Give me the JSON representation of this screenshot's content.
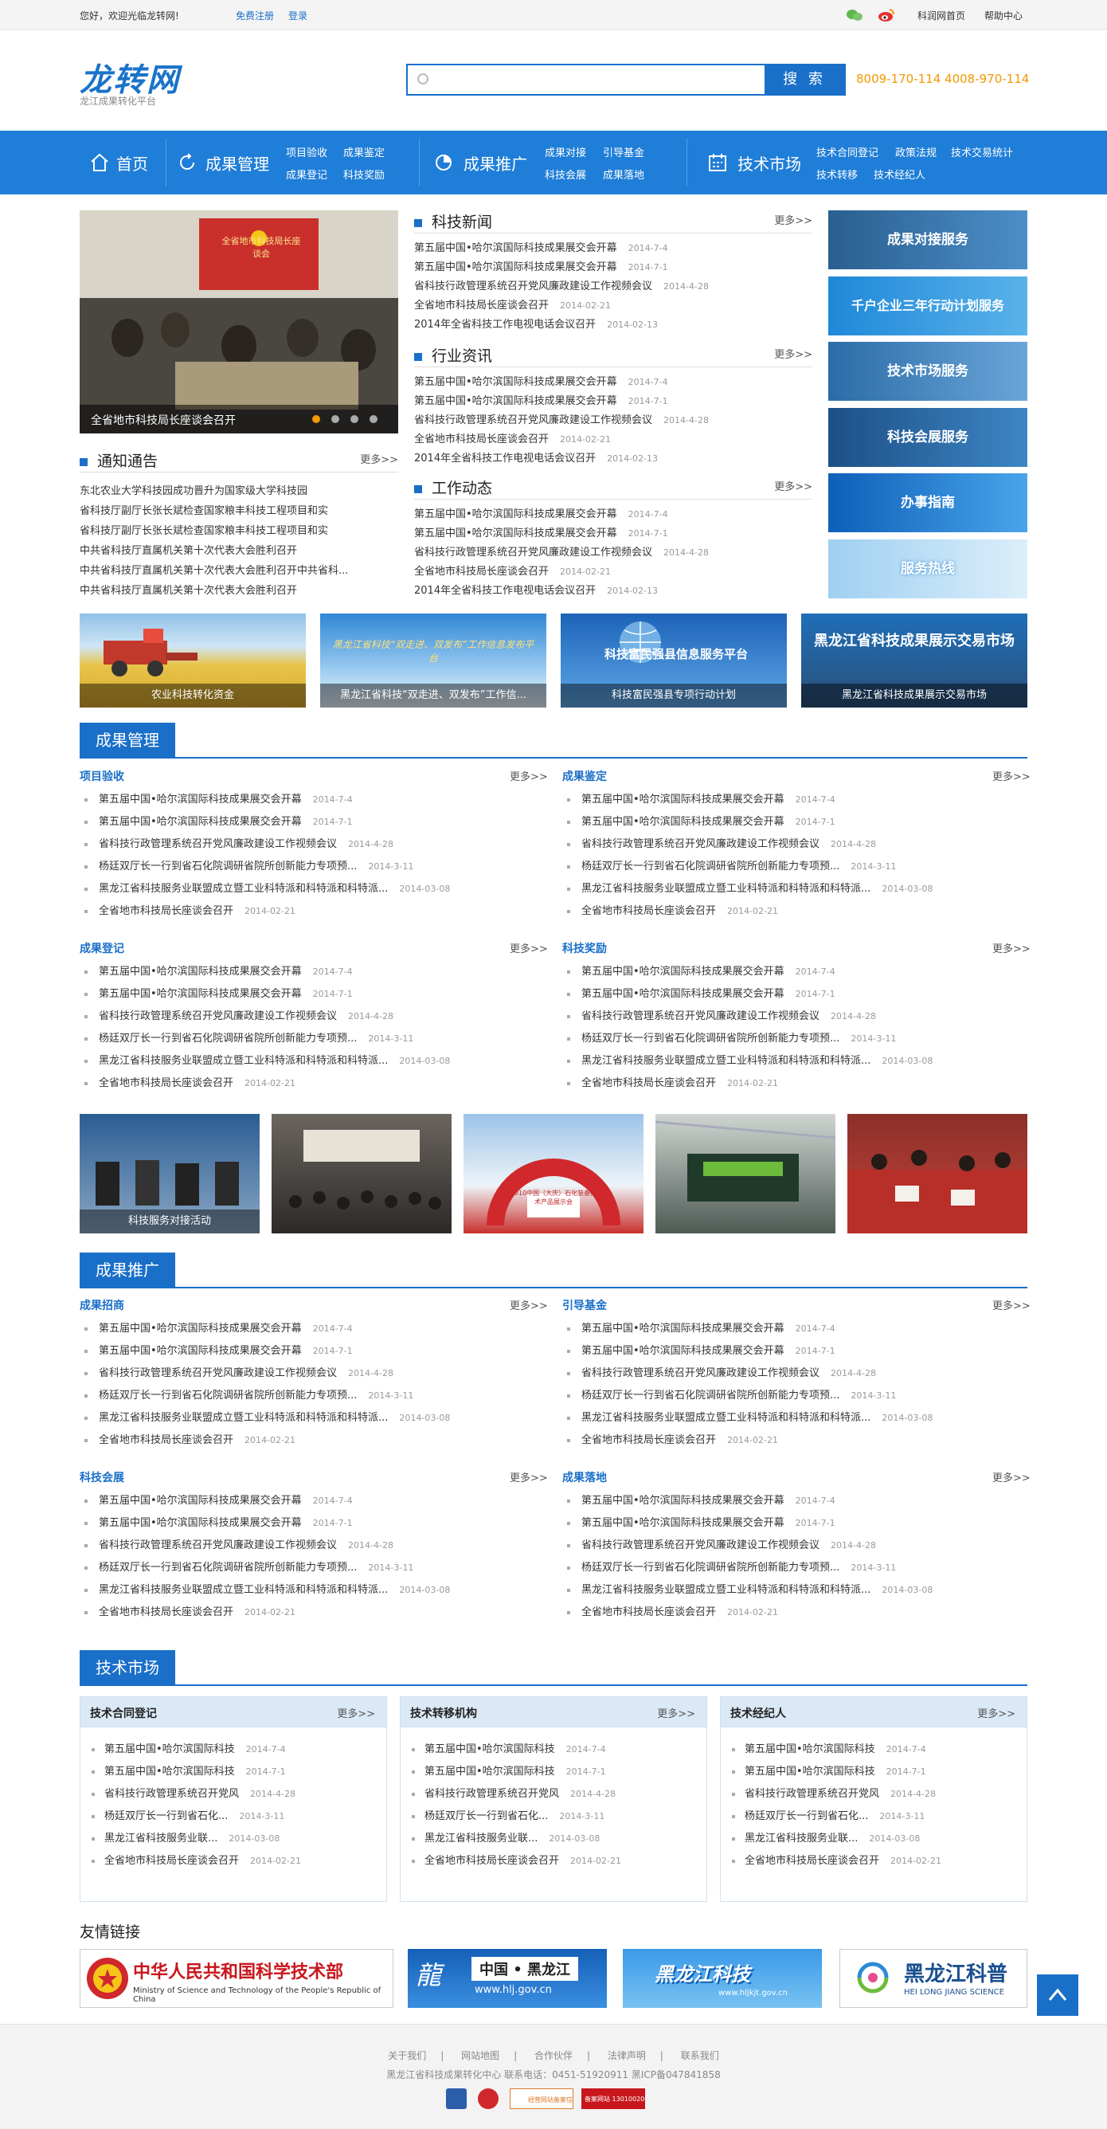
{
  "topbar": {
    "welcome": "您好，欢迎光临龙转网!",
    "register": "免费注册",
    "login": "登录",
    "home_link": "科润网首页",
    "help": "帮助中心"
  },
  "header": {
    "logo": "龙转网",
    "logo_sub": "龙江成果转化平台",
    "search_placeholder": "",
    "search_button": "搜 索",
    "hotline": "8009-170-114  4008-970-114"
  },
  "nav": {
    "home": "首页",
    "groups": [
      {
        "title": "成果管理",
        "subs": [
          "项目验收",
          "成果鉴定",
          "成果登记",
          "科技奖励"
        ]
      },
      {
        "title": "成果推广",
        "subs": [
          "成果对接",
          "引导基金",
          "科技会展",
          "成果落地"
        ]
      },
      {
        "title": "技术市场",
        "subs": [
          "技术合同登记",
          "政策法规",
          "技术交易统计",
          "技术转移",
          "技术经纪人"
        ]
      }
    ]
  },
  "slider": {
    "caption": "全省地市科技局长座谈会召开",
    "projected_text": "全省地市科技局长座谈会"
  },
  "notice": {
    "title": "通知通告",
    "more": "更多>>",
    "items": [
      "东北农业大学科技园成功晋升为国家级大学科技园",
      "省科技厅副厅长张长斌检查国家粮丰科技工程项目和实",
      "省科技厅副厅长张长斌检查国家粮丰科技工程项目和实",
      "中共省科技厅直属机关第十次代表大会胜利召开",
      "中共省科技厅直属机关第十次代表大会胜利召开中共省科...",
      "中共省科技厅直属机关第十次代表大会胜利召开"
    ]
  },
  "news_sections": [
    {
      "title": "科技新闻",
      "more": "更多>>",
      "items": [
        [
          "第五届中国•哈尔滨国际科技成果展交会开幕",
          "2014-7-4"
        ],
        [
          "第五届中国•哈尔滨国际科技成果展交会开幕",
          "2014-7-1"
        ],
        [
          "省科技行政管理系统召开党风廉政建设工作视频会议",
          "2014-4-28"
        ],
        [
          "全省地市科技局长座谈会召开",
          "2014-02-21"
        ],
        [
          "2014年全省科技工作电视电话会议召开",
          "2014-02-13"
        ]
      ]
    },
    {
      "title": "行业资讯",
      "more": "更多>>",
      "items": [
        [
          "第五届中国•哈尔滨国际科技成果展交会开幕",
          "2014-7-4"
        ],
        [
          "第五届中国•哈尔滨国际科技成果展交会开幕",
          "2014-7-1"
        ],
        [
          "省科技行政管理系统召开党风廉政建设工作视频会议",
          "2014-4-28"
        ],
        [
          "全省地市科技局长座谈会召开",
          "2014-02-21"
        ],
        [
          "2014年全省科技工作电视电话会议召开",
          "2014-02-13"
        ]
      ]
    },
    {
      "title": "工作动态",
      "more": "更多>>",
      "items": [
        [
          "第五届中国•哈尔滨国际科技成果展交会开幕",
          "2014-7-4"
        ],
        [
          "第五届中国•哈尔滨国际科技成果展交会开幕",
          "2014-7-1"
        ],
        [
          "省科技行政管理系统召开党风廉政建设工作视频会议",
          "2014-4-28"
        ],
        [
          "全省地市科技局长座谈会召开",
          "2014-02-21"
        ],
        [
          "2014年全省科技工作电视电话会议召开",
          "2014-02-13"
        ]
      ]
    }
  ],
  "services": [
    "成果对接服务",
    "千户企业三年行动计划服务",
    "技术市场服务",
    "科技会展服务",
    "办事指南",
    "服务热线"
  ],
  "banners": [
    {
      "caption": "农业科技转化资金",
      "inner": ""
    },
    {
      "caption": "黑龙江省科技“双走进、双发布”工作信...",
      "inner": "黑龙江省科技“双走进、双发布”工作信息发布平台"
    },
    {
      "caption": "科技富民强县专项行动计划",
      "inner": "科技富民强县信息服务平台"
    },
    {
      "caption": "黑龙江省科技成果展示交易市场",
      "inner": "黑龙江省科技成果展示交易市场"
    }
  ],
  "list_template": [
    [
      "第五届中国•哈尔滨国际科技成果展交会开幕",
      "2014-7-4"
    ],
    [
      "第五届中国•哈尔滨国际科技成果展交会开幕",
      "2014-7-1"
    ],
    [
      "省科技行政管理系统召开党风廉政建设工作视频会议",
      "2014-4-28"
    ],
    [
      "杨廷双厅长一行到省石化院调研省院所创新能力专项预...",
      "2014-3-11"
    ],
    [
      "黑龙江省科技服务业联盟成立暨工业科特派和科特派和科特派...",
      "2014-03-08"
    ],
    [
      "全省地市科技局长座谈会召开",
      "2014-02-21"
    ]
  ],
  "cgl": {
    "title": "成果管理",
    "subs": [
      "项目验收",
      "成果鉴定",
      "成果登记",
      "科技奖励"
    ],
    "more": "更多>>"
  },
  "photos": {
    "first_caption": "科技服务对接活动",
    "expo_sign": "2010中国（大庆）石化装备技术产品展示会"
  },
  "cgtg": {
    "title": "成果推广",
    "subs": [
      "成果招商",
      "引导基金",
      "科技会展",
      "成果落地"
    ],
    "more": "更多>>"
  },
  "jssc": {
    "title": "技术市场",
    "boxes": [
      {
        "title": "技术合同登记",
        "more": "更多>>",
        "items": [
          [
            "第五届中国•哈尔滨国际科技",
            "2014-7-4"
          ],
          [
            "第五届中国•哈尔滨国际科技",
            "2014-7-1"
          ],
          [
            "省科技行政管理系统召开党风",
            "2014-4-28"
          ],
          [
            "杨廷双厅长一行到省石化...",
            "2014-3-11"
          ],
          [
            "黑龙江省科技服务业联...",
            "2014-03-08"
          ],
          [
            "全省地市科技局长座谈会召开",
            "2014-02-21"
          ]
        ]
      },
      {
        "title": "技术转移机构",
        "more": "更多>>",
        "items": [
          [
            "第五届中国•哈尔滨国际科技",
            "2014-7-4"
          ],
          [
            "第五届中国•哈尔滨国际科技",
            "2014-7-1"
          ],
          [
            "省科技行政管理系统召开党风",
            "2014-4-28"
          ],
          [
            "杨廷双厅长一行到省石化...",
            "2014-3-11"
          ],
          [
            "黑龙江省科技服务业联...",
            "2014-03-08"
          ],
          [
            "全省地市科技局长座谈会召开",
            "2014-02-21"
          ]
        ]
      },
      {
        "title": "技术经纪人",
        "more": "更多>>",
        "items": [
          [
            "第五届中国•哈尔滨国际科技",
            "2014-7-4"
          ],
          [
            "第五届中国•哈尔滨国际科技",
            "2014-7-1"
          ],
          [
            "省科技行政管理系统召开党风",
            "2014-4-28"
          ],
          [
            "杨廷双厅长一行到省石化...",
            "2014-3-11"
          ],
          [
            "黑龙江省科技服务业联...",
            "2014-03-08"
          ],
          [
            "全省地市科技局长座谈会召开",
            "2014-02-21"
          ]
        ]
      }
    ]
  },
  "links": {
    "title": "友情链接",
    "items": [
      {
        "name": "中华人民共和国科学技术部",
        "sub": "Ministry of Science and Technology of the People's Republic of China"
      },
      {
        "name": "中国 • 黑龙江",
        "sub": "www.hlj.gov.cn"
      },
      {
        "name": "黑龙江科技",
        "sub": "www.hljkjt.gov.cn"
      },
      {
        "name": "黑龙江科普",
        "sub": "HEI LONG JIANG SCIENCE"
      }
    ]
  },
  "footer": {
    "links": [
      "关于我们",
      "网站地图",
      "合作伙伴",
      "法律声明",
      "联系我们"
    ],
    "line2": "黑龙江省科技成果转化中心    联系电话：0451-51920911    黑ICP备047841858",
    "badge_texts": [
      "经营网站备案信息",
      "备案网站 13010020080360"
    ]
  },
  "colors": {
    "brand": "#1a6fc9",
    "nav": "#1f7ed8",
    "hotline": "#f39800"
  }
}
